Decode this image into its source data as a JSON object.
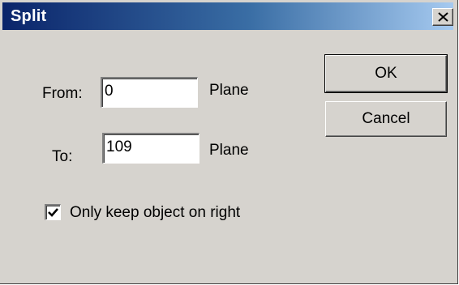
{
  "dialog": {
    "title": "Split",
    "close_icon": "close-icon"
  },
  "from": {
    "label": "From:",
    "value": "0",
    "unit": "Plane"
  },
  "to": {
    "label": "To:",
    "value": "109",
    "unit": "Plane"
  },
  "option": {
    "label": "Only keep object on right",
    "checked": true
  },
  "buttons": {
    "ok_label": "OK",
    "cancel_label": "Cancel"
  },
  "colors": {
    "titlebar_start": "#0a246a",
    "titlebar_end": "#a6caf0",
    "face": "#d6d3ce"
  }
}
